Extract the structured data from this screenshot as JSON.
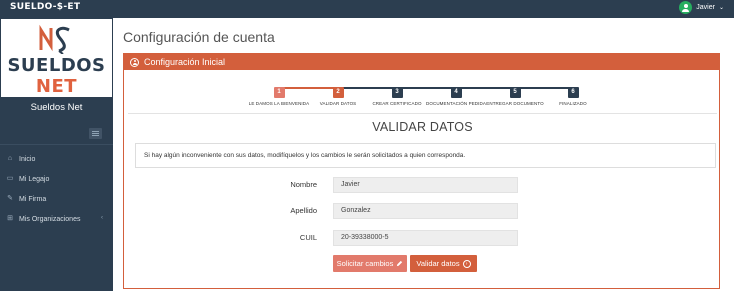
{
  "topbar": {
    "brand": "SUELDO-$-ET",
    "user_name": "Javier",
    "user_caret": "⌄"
  },
  "sidebar": {
    "logo": {
      "text_left": "SUELDOS",
      "text_right": "NET"
    },
    "site_name": "Sueldos Net",
    "menu": [
      {
        "label": "Inicio",
        "icon": "home-icon"
      },
      {
        "label": "Mi Legajo",
        "icon": "inbox-icon"
      },
      {
        "label": "Mi Firma",
        "icon": "pencil-square-icon"
      },
      {
        "label": "Mis Organizaciones",
        "icon": "organization-icon",
        "chevron": "‹"
      }
    ]
  },
  "main": {
    "page_title": "Configuración de cuenta",
    "card_header": "Configuración Inicial",
    "steps": [
      {
        "num": "1",
        "label": "LE DAMOS LA BIENVENIDA",
        "state": "done"
      },
      {
        "num": "2",
        "label": "VALIDAR DATOS",
        "state": "current"
      },
      {
        "num": "3",
        "label": "CREAR CERTIFICADO",
        "state": "pending"
      },
      {
        "num": "4",
        "label": "DOCUMENTACIÓN PEDIDA",
        "state": "pending"
      },
      {
        "num": "5",
        "label": "ENTREGAR DOCUMENTO",
        "state": "pending"
      },
      {
        "num": "6",
        "label": "FINALIZADO",
        "state": "pending"
      }
    ],
    "section_title": "VALIDAR DATOS",
    "info_text": "Si hay algún inconveniente con sus datos, modifíquelos y los cambios le serán solicitados a quien corresponda.",
    "form": [
      {
        "label": "Nombre",
        "value": "Javier"
      },
      {
        "label": "Apellido",
        "value": "Gonzalez"
      },
      {
        "label": "CUIL",
        "value": "20-39338000-5"
      }
    ],
    "buttons": {
      "edit_label": "Solicitar cambios",
      "validate_label": "Validar datos"
    }
  },
  "colors": {
    "accent": "#d35f3c",
    "accent_light": "#e27a6b",
    "dark": "#2c3e50",
    "step_pending": "#2c3e50",
    "avatar": "#27ae60"
  }
}
